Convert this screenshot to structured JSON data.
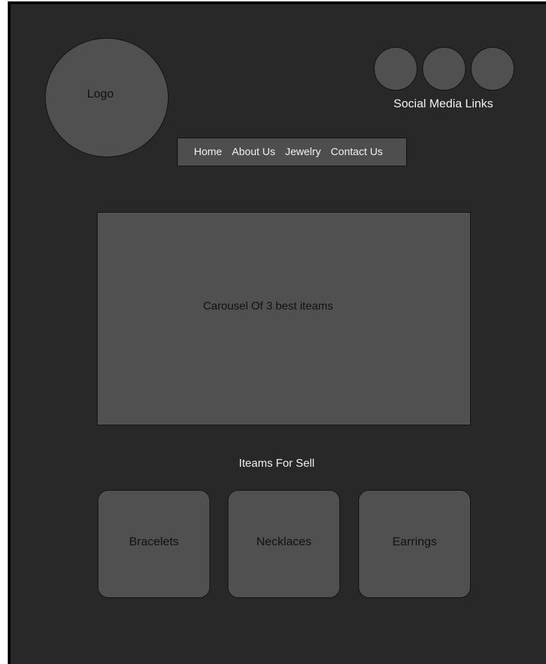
{
  "header": {
    "logo_label": "Logo",
    "social": {
      "label": "Social Media Links",
      "icons": [
        "social-link-icon",
        "social-link-icon",
        "social-link-icon"
      ]
    }
  },
  "nav": {
    "items": [
      "Home",
      "About Us",
      "Jewelry",
      "Contact Us"
    ]
  },
  "carousel": {
    "label": "Carousel Of 3 best iteams"
  },
  "items_section": {
    "title": "Iteams For Sell",
    "cards": [
      "Bracelets",
      "Necklaces",
      "Earrings"
    ]
  },
  "colors": {
    "background": "#282828",
    "panel": "#505050",
    "border": "#111111",
    "light_text": "#f2f2f2"
  }
}
